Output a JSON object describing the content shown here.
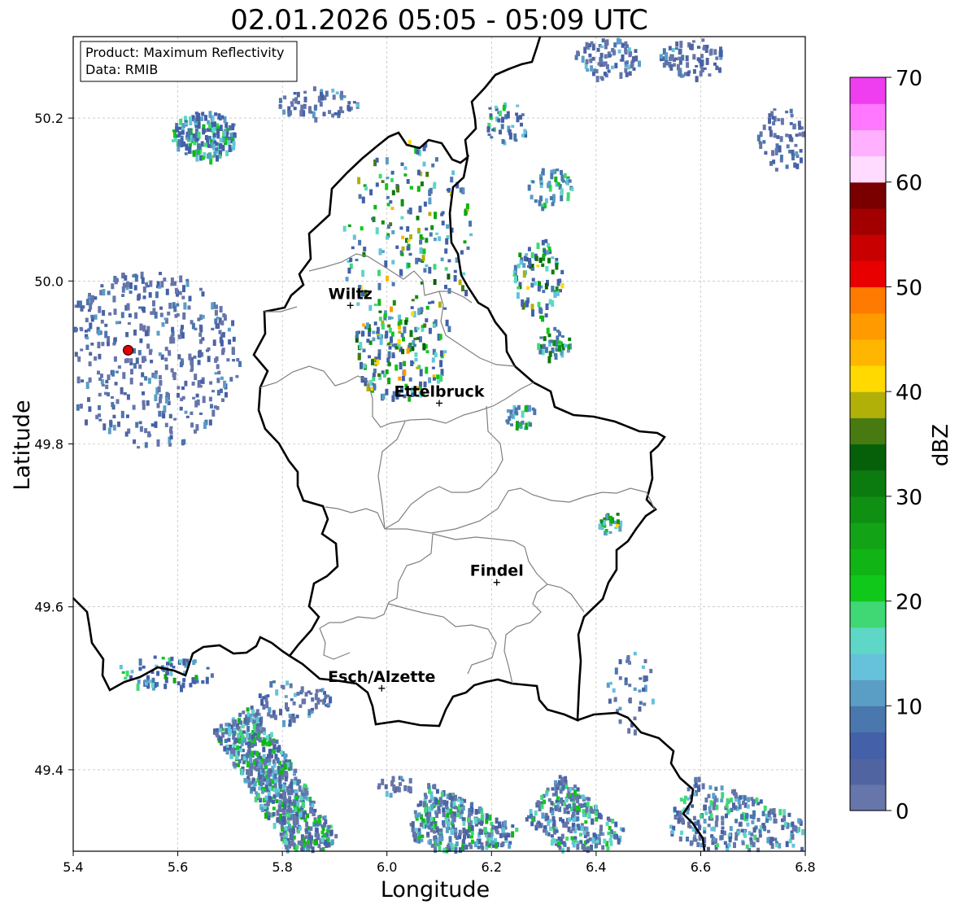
{
  "title": "02.01.2026 05:05 - 05:09 UTC",
  "info_box": {
    "product": "Product: Maximum Reflectivity",
    "data": "Data: RMIB"
  },
  "map": {
    "xlabel": "Longitude",
    "ylabel": "Latitude",
    "xlim": [
      5.4,
      6.8
    ],
    "ylim": [
      49.3,
      50.3
    ],
    "xticks": [
      "5.4",
      "5.6",
      "5.8",
      "6.0",
      "6.2",
      "6.4",
      "6.6",
      "6.8"
    ],
    "yticks": [
      "49.4",
      "49.6",
      "49.8",
      "50.0",
      "50.2"
    ],
    "grid": true,
    "cities": [
      {
        "name": "Wiltz",
        "lon": 5.93,
        "lat": 49.97
      },
      {
        "name": "Ettelbruck",
        "lon": 6.1,
        "lat": 49.85
      },
      {
        "name": "Findel",
        "lon": 6.21,
        "lat": 49.63
      },
      {
        "name": "Esch/Alzette",
        "lon": 5.99,
        "lat": 49.5
      }
    ],
    "radar_site": {
      "lon": 5.505,
      "lat": 49.915,
      "color": "#e00000"
    }
  },
  "colorbar": {
    "label": "dBZ",
    "range": [
      0,
      70
    ],
    "ticks": [
      "0",
      "10",
      "20",
      "30",
      "40",
      "50",
      "60",
      "70"
    ],
    "colors": [
      "#6675aa",
      "#4f64a0",
      "#4360a8",
      "#4a77ad",
      "#5a9ec6",
      "#65c2da",
      "#5ed7c6",
      "#3fd874",
      "#10c81a",
      "#11b415",
      "#12a416",
      "#0f9012",
      "#0b7a0f",
      "#06600a",
      "#477a10",
      "#b0b008",
      "#ffd900",
      "#ffb600",
      "#ff9a00",
      "#ff7a00",
      "#e80000",
      "#c80000",
      "#a20000",
      "#7a0000",
      "#ffdcff",
      "#ffb0ff",
      "#ff78ff",
      "#ee3ef0"
    ]
  }
}
